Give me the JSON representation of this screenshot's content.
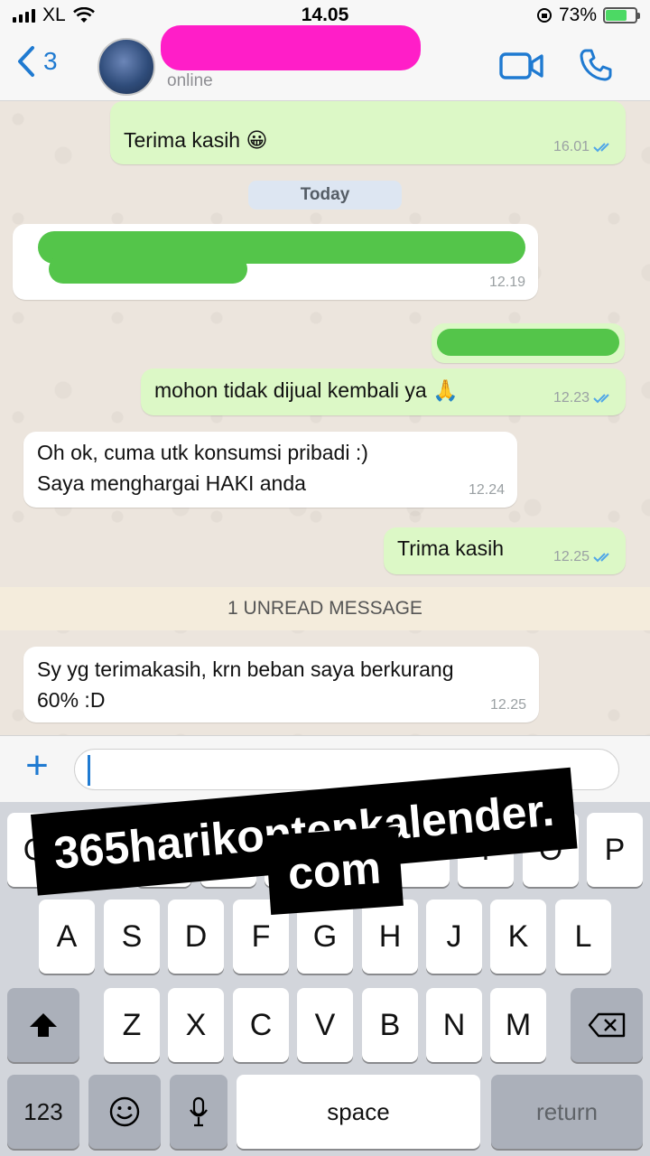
{
  "status": {
    "carrier": "XL",
    "time": "14.05",
    "battery": "73%",
    "battery_level": 0.73
  },
  "header": {
    "back_count": "3",
    "presence": "online"
  },
  "chat": {
    "messages": [
      {
        "text": "Terima kasih 😀",
        "time": "16.01"
      },
      {
        "text": "mohon tidak dijual kembali ya 🙏",
        "time": "12.23"
      },
      {
        "line1": "Oh ok, cuma utk konsumsi pribadi :)",
        "line2": "Saya menghargai HAKI anda",
        "time": "12.24"
      },
      {
        "text": "Trima kasih",
        "time": "12.25"
      },
      {
        "line1": "Sy yg terimakasih, krn beban saya berkurang",
        "line2": "60% :D",
        "time": "12.25"
      }
    ],
    "redacted_time": "12.19",
    "day_label": "Today",
    "unread_label": "1 UNREAD MESSAGE"
  },
  "keyboard": {
    "row1": [
      "Q",
      "W",
      "E",
      "R",
      "T",
      "Y",
      "U",
      "I",
      "O",
      "P"
    ],
    "row2": [
      "A",
      "S",
      "D",
      "F",
      "G",
      "H",
      "J",
      "K",
      "L"
    ],
    "row3": [
      "Z",
      "X",
      "C",
      "V",
      "B",
      "N",
      "M"
    ],
    "numbers": "123",
    "space": "space",
    "return": "return"
  },
  "watermark": {
    "line1": "365harikontenkalender.",
    "line2": "com"
  }
}
